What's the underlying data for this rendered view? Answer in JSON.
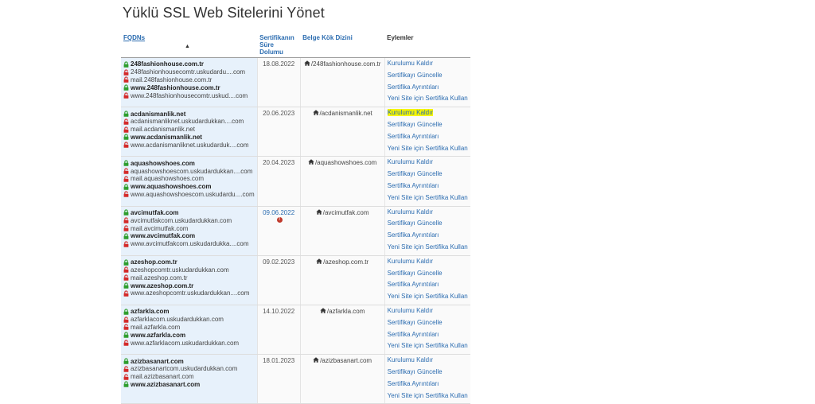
{
  "page_title": "Yüklü SSL Web Sitelerini Yönet",
  "headers": {
    "fqdns": "FQDNs",
    "expiry_line1": "Sertifikanın",
    "expiry_line2": "Süre Dolumu",
    "docroot": "Belge Kök Dizini",
    "actions": "Eylemler"
  },
  "action_labels": {
    "uninstall": "Kurulumu Kaldır",
    "update": "Sertifikayı Güncelle",
    "details": "Sertifika Ayrıntıları",
    "new_site": "Yeni Site için Sertifika Kullan"
  },
  "colors": {
    "link": "#2b6cb0",
    "lock_ok": "#2e9e2e",
    "lock_bad": "#d42a2a",
    "row_fqdn_bg": "#e7f1fb",
    "highlight": "#f5f500"
  },
  "rows": [
    {
      "fqdns": [
        {
          "text": "248fashionhouse.com.tr",
          "lock": "ok",
          "primary": true
        },
        {
          "text": "248fashionhousecomtr.uskudardu....com",
          "lock": "bad",
          "primary": false
        },
        {
          "text": "mail.248fashionhouse.com.tr",
          "lock": "bad",
          "primary": false
        },
        {
          "text": "www.248fashionhouse.com.tr",
          "lock": "ok",
          "primary": true
        },
        {
          "text": "www.248fashionhousecomtr.uskud....com",
          "lock": "bad",
          "primary": false
        }
      ],
      "expiry": "18.08.2022",
      "expiry_warn": false,
      "docroot": "/248fashionhouse.com.tr",
      "highlight_uninstall": false
    },
    {
      "fqdns": [
        {
          "text": "acdanismanlik.net",
          "lock": "ok",
          "primary": true
        },
        {
          "text": "acdanismanliknet.uskudardukkan....com",
          "lock": "bad",
          "primary": false
        },
        {
          "text": "mail.acdanismanlik.net",
          "lock": "bad",
          "primary": false
        },
        {
          "text": "www.acdanismanlik.net",
          "lock": "ok",
          "primary": true
        },
        {
          "text": "www.acdanismanliknet.uskudarduk....com",
          "lock": "bad",
          "primary": false
        }
      ],
      "expiry": "20.06.2023",
      "expiry_warn": false,
      "docroot": "/acdanismanlik.net",
      "highlight_uninstall": true
    },
    {
      "fqdns": [
        {
          "text": "aquashowshoes.com",
          "lock": "ok",
          "primary": true
        },
        {
          "text": "aquashowshoescom.uskudardukkan....com",
          "lock": "bad",
          "primary": false
        },
        {
          "text": "mail.aquashowshoes.com",
          "lock": "bad",
          "primary": false
        },
        {
          "text": "www.aquashowshoes.com",
          "lock": "ok",
          "primary": true
        },
        {
          "text": "www.aquashowshoescom.uskudardu....com",
          "lock": "bad",
          "primary": false
        }
      ],
      "expiry": "20.04.2023",
      "expiry_warn": false,
      "docroot": "/aquashowshoes.com",
      "highlight_uninstall": false
    },
    {
      "fqdns": [
        {
          "text": "avcimutfak.com",
          "lock": "ok",
          "primary": true
        },
        {
          "text": "avcimutfakcom.uskudardukkan.com",
          "lock": "bad",
          "primary": false
        },
        {
          "text": "mail.avcimutfak.com",
          "lock": "bad",
          "primary": false
        },
        {
          "text": "www.avcimutfak.com",
          "lock": "ok",
          "primary": true
        },
        {
          "text": "www.avcimutfakcom.uskudardukka....com",
          "lock": "bad",
          "primary": false
        }
      ],
      "expiry": "09.06.2022",
      "expiry_warn": true,
      "docroot": "/avcimutfak.com",
      "highlight_uninstall": false
    },
    {
      "fqdns": [
        {
          "text": "azeshop.com.tr",
          "lock": "ok",
          "primary": true
        },
        {
          "text": "azeshopcomtr.uskudardukkan.com",
          "lock": "bad",
          "primary": false
        },
        {
          "text": "mail.azeshop.com.tr",
          "lock": "bad",
          "primary": false
        },
        {
          "text": "www.azeshop.com.tr",
          "lock": "ok",
          "primary": true
        },
        {
          "text": "www.azeshopcomtr.uskudardukkan....com",
          "lock": "bad",
          "primary": false
        }
      ],
      "expiry": "09.02.2023",
      "expiry_warn": false,
      "docroot": "/azeshop.com.tr",
      "highlight_uninstall": false
    },
    {
      "fqdns": [
        {
          "text": "azfarkla.com",
          "lock": "ok",
          "primary": true
        },
        {
          "text": "azfarklacom.uskudardukkan.com",
          "lock": "bad",
          "primary": false
        },
        {
          "text": "mail.azfarkla.com",
          "lock": "bad",
          "primary": false
        },
        {
          "text": "www.azfarkla.com",
          "lock": "ok",
          "primary": true
        },
        {
          "text": "www.azfarklacom.uskudardukkan.com",
          "lock": "bad",
          "primary": false
        }
      ],
      "expiry": "14.10.2022",
      "expiry_warn": false,
      "docroot": "/azfarkla.com",
      "highlight_uninstall": false
    },
    {
      "fqdns": [
        {
          "text": "azizbasanart.com",
          "lock": "ok",
          "primary": true
        },
        {
          "text": "azizbasanartcom.uskudardukkan.com",
          "lock": "bad",
          "primary": false
        },
        {
          "text": "mail.azizbasanart.com",
          "lock": "bad",
          "primary": false
        },
        {
          "text": "www.azizbasanart.com",
          "lock": "ok",
          "primary": true
        }
      ],
      "expiry": "18.01.2023",
      "expiry_warn": false,
      "docroot": "/azizbasanart.com",
      "highlight_uninstall": false
    }
  ]
}
